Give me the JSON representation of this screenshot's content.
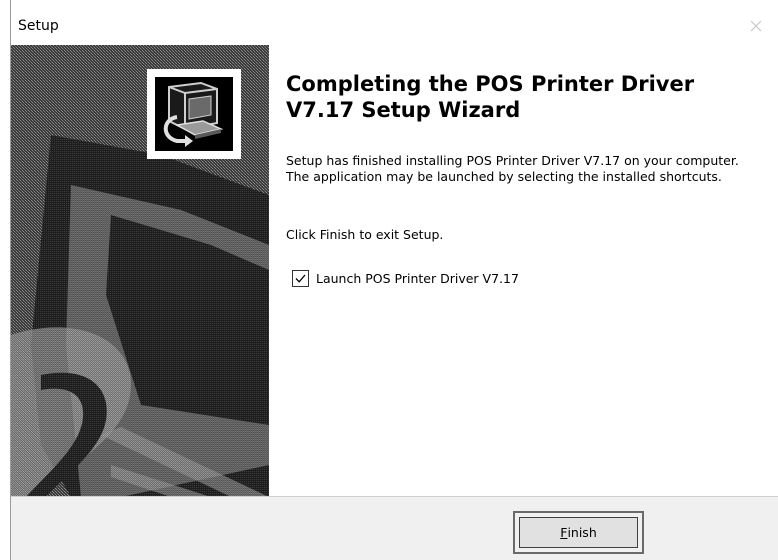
{
  "window": {
    "title": "Setup",
    "close_icon": "close-icon"
  },
  "side_panel": {
    "logo_icon": "printer-install-icon"
  },
  "content": {
    "heading": "Completing the POS Printer Driver V7.17 Setup Wizard",
    "description": "Setup has finished installing POS Printer Driver V7.17 on your computer. The application may be launched by selecting the installed shortcuts.",
    "click_finish": "Click Finish to exit Setup.",
    "launch_checkbox": {
      "label": "Launch POS Printer Driver V7.17",
      "checked": true
    }
  },
  "footer": {
    "finish_label_first": "F",
    "finish_label_rest": "inish"
  },
  "colors": {
    "side_panel_dark": "#2b2b2b",
    "side_panel_mid": "#6e6e6e",
    "footer_bg": "#f0f0f0"
  }
}
